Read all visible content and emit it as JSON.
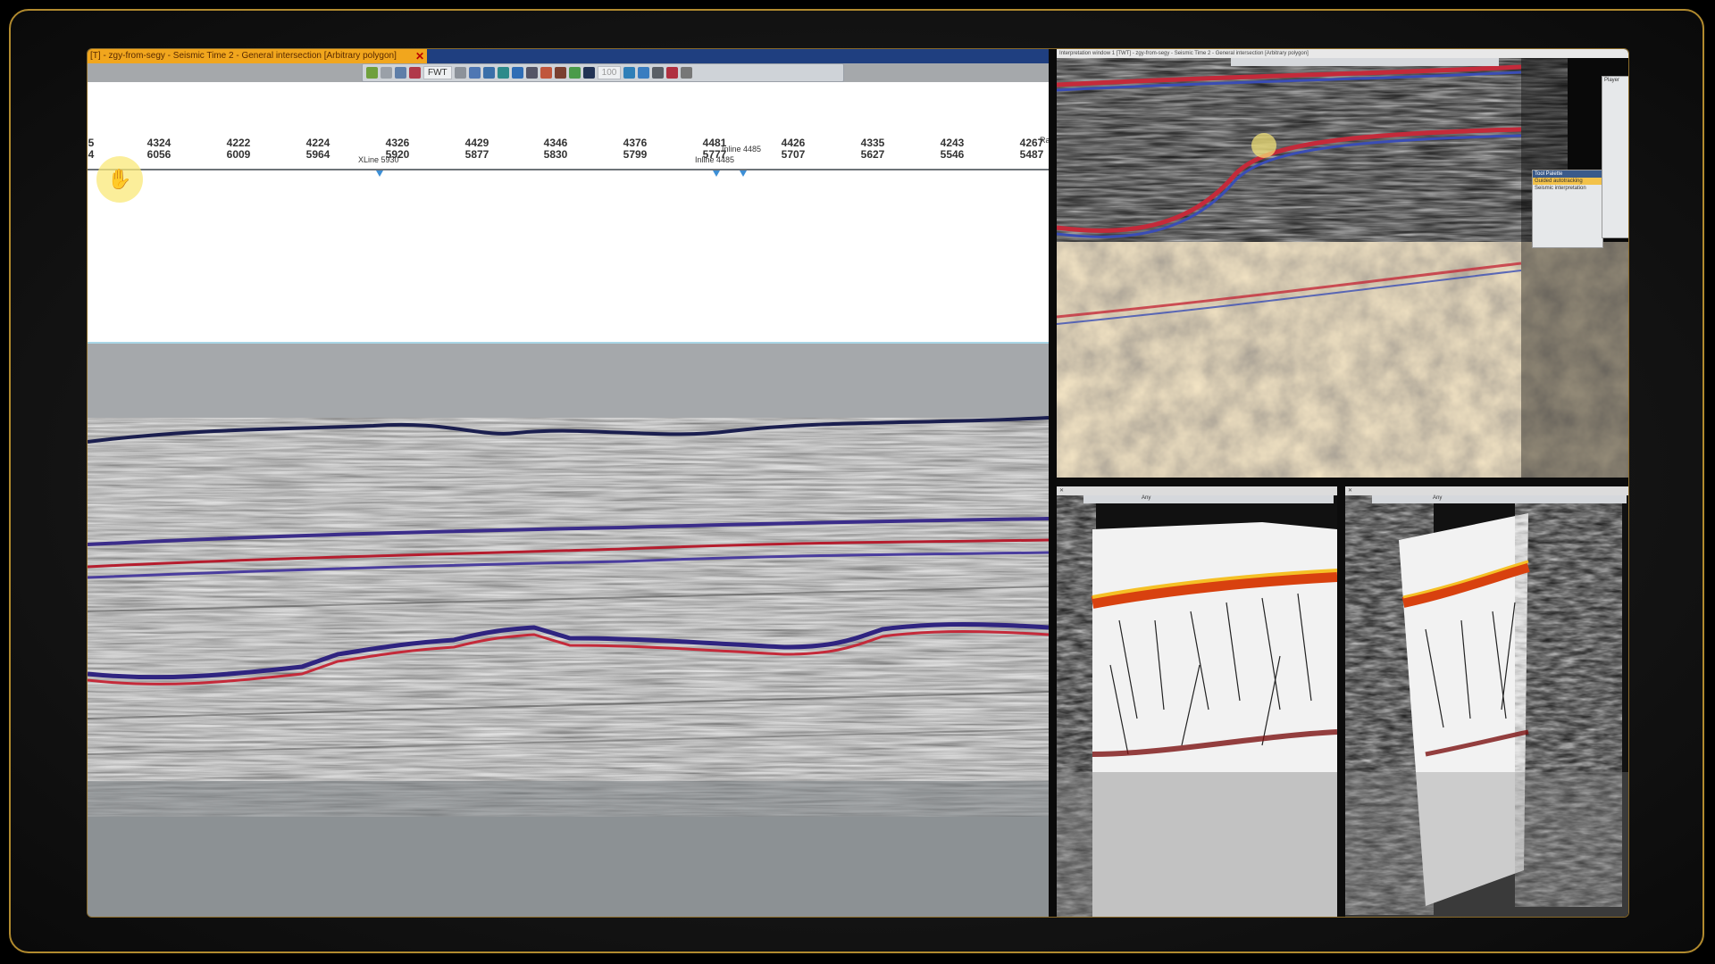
{
  "left_window": {
    "title": "[T] - zgy-from-segy - Seismic Time 2 - General intersection [Arbitrary polygon]",
    "close_glyph": "✕",
    "toolbar": {
      "domain_select": "FWT",
      "value_field": "100",
      "icons": [
        "refresh-icon",
        "pointer-icon",
        "view-icon",
        "flag-icon",
        "bars-icon",
        "home-icon",
        "eye-icon",
        "globe-icon",
        "layers-icon",
        "zoom-icon",
        "paint-icon",
        "people-icon",
        "fit-icon",
        "grid-icon",
        "pick-icon",
        "window-icon",
        "settings-icon",
        "pin-icon"
      ]
    },
    "axis": {
      "ticks": [
        {
          "top": "5",
          "bottom": "4"
        },
        {
          "top": "4324",
          "bottom": "6056"
        },
        {
          "top": "4222",
          "bottom": "6009"
        },
        {
          "top": "4224",
          "bottom": "5964"
        },
        {
          "top": "4326",
          "bottom": "5920"
        },
        {
          "top": "4429",
          "bottom": "5877"
        },
        {
          "top": "4346",
          "bottom": "5830"
        },
        {
          "top": "4376",
          "bottom": "5799"
        },
        {
          "top": "4481",
          "bottom": "5777"
        },
        {
          "top": "4426",
          "bottom": "5707"
        },
        {
          "top": "4335",
          "bottom": "5627"
        },
        {
          "top": "4243",
          "bottom": "5546"
        },
        {
          "top": "4267",
          "bottom": "5487"
        }
      ],
      "edge_label": "Ra",
      "markers": [
        {
          "label": "XLine 5930"
        },
        {
          "label": "Inline 4485"
        },
        {
          "label": "Inline 4485"
        }
      ]
    },
    "hand_icon": "✋"
  },
  "right_top": {
    "title": "Interpretation window 1 [TWT] - zgy-from-segy - Seismic Time 2 - General intersection [Arbitrary polygon]",
    "palette_title": "Tool Palette",
    "palette_item": "Guided autotracking",
    "palette_item2": "Seismic interpretation",
    "side_title": "Player"
  },
  "right_bottom_left": {
    "close_glyph": "✕",
    "select": "Any"
  },
  "right_bottom_right": {
    "close_glyph": "✕",
    "select": "Any"
  },
  "colors": {
    "accent": "#b18a2e",
    "title_tab": "#f1a61d",
    "titlebar": "#1f3f80",
    "marker": "#3d8fd6"
  }
}
